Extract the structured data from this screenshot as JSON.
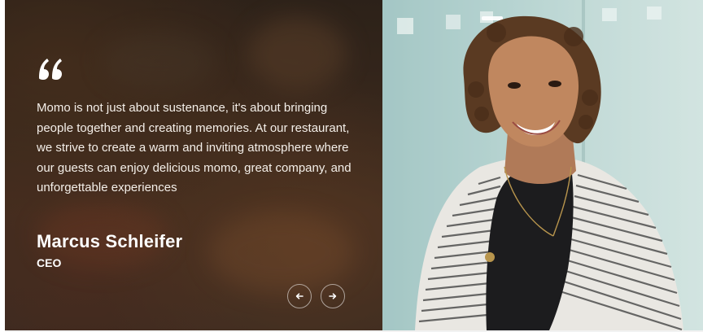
{
  "testimonial": {
    "quote_icon": "quote-icon",
    "quote": "Momo is not just about sustenance, it's about bringing people together and creating memories. At our restaurant, we strive to create a warm and inviting atmosphere where our guests can enjoy delicious momo, great company, and unforgettable experiences",
    "author_name": "Marcus Schleifer",
    "author_title": "CEO"
  },
  "navigation": {
    "prev_icon": "arrow-left-icon",
    "next_icon": "arrow-right-icon"
  },
  "colors": {
    "text": "#ffffff",
    "panel_bg": "#3a2c22",
    "photo_bg": "#b6d3d1"
  }
}
